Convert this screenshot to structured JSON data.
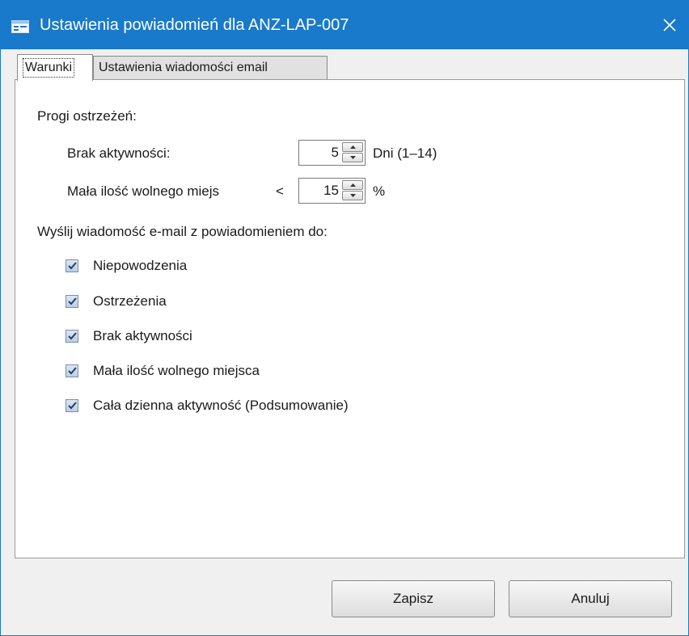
{
  "window": {
    "title": "Ustawienia powiadomień dla ANZ-LAP-007"
  },
  "tabs": [
    {
      "label": "Warunki",
      "active": true
    },
    {
      "label": "Ustawienia wiadomości email",
      "active": false
    }
  ],
  "thresholds": {
    "heading": "Progi ostrzeżeń:",
    "inactivity": {
      "label": "Brak aktywności:",
      "value": "5",
      "unit": "Dni (1–14)"
    },
    "low_space": {
      "label": "Mała ilość wolnego miejs",
      "operator": "<",
      "value": "15",
      "unit": "%"
    }
  },
  "email_section": {
    "heading": "Wyślij wiadomość e-mail z powiadomieniem do:",
    "options": [
      {
        "label": "Niepowodzenia",
        "checked": true
      },
      {
        "label": "Ostrzeżenia",
        "checked": true
      },
      {
        "label": "Brak aktywności",
        "checked": true
      },
      {
        "label": "Mała ilość wolnego miejsca",
        "checked": true
      },
      {
        "label": "Cała dzienna aktywność (Podsumowanie)",
        "checked": true
      }
    ]
  },
  "buttons": {
    "save": "Zapisz",
    "cancel": "Anuluj"
  },
  "colors": {
    "titlebar": "#1979ca",
    "checkbox_fill": "#c9dbef"
  },
  "icons": {
    "app": "dialog-icon",
    "close": "close-icon",
    "spin_up": "arrow-up-icon",
    "spin_down": "arrow-down-icon",
    "check": "checkmark-icon"
  }
}
